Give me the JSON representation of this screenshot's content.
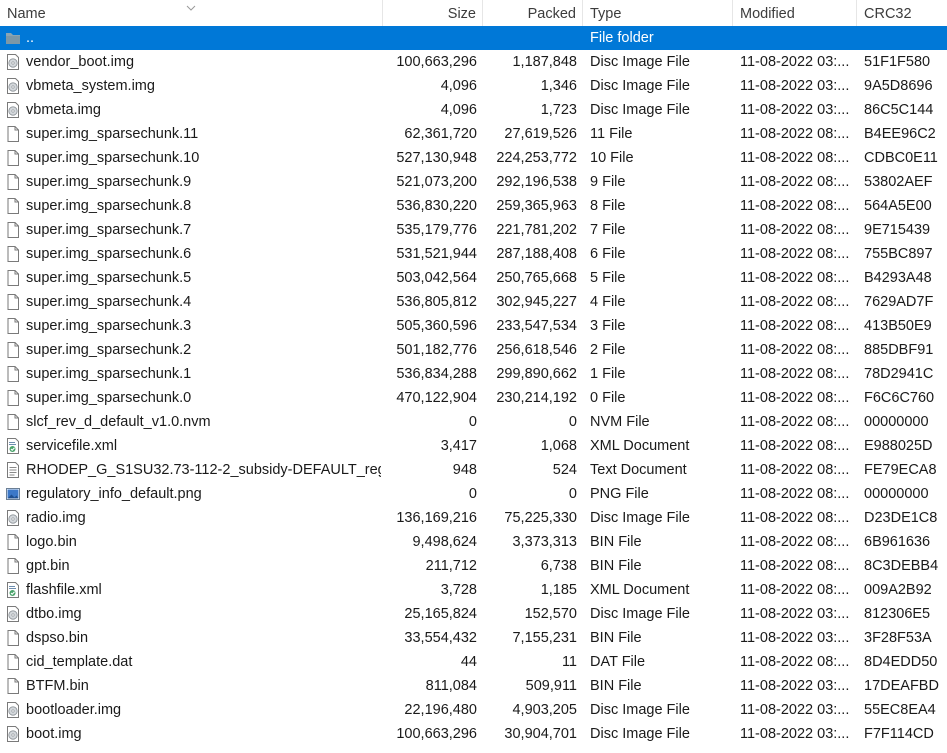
{
  "columns": {
    "name": "Name",
    "size": "Size",
    "packed": "Packed",
    "type": "Type",
    "modified": "Modified",
    "crc": "CRC32"
  },
  "sort": {
    "column": "name",
    "icon": "chevron-down-icon"
  },
  "colors": {
    "selection": "#0078d7",
    "header_text": "#3c3c3c",
    "folder": "#8ba5b3"
  },
  "rows": [
    {
      "name": "..",
      "size": "",
      "packed": "",
      "type": "File folder",
      "modified": "",
      "crc": "",
      "icon": "folder-icon",
      "selected": true
    },
    {
      "name": "vendor_boot.img",
      "size": "100,663,296",
      "packed": "1,187,848",
      "type": "Disc Image File",
      "modified": "11-08-2022 03:...",
      "crc": "51F1F580",
      "icon": "disc-image-icon"
    },
    {
      "name": "vbmeta_system.img",
      "size": "4,096",
      "packed": "1,346",
      "type": "Disc Image File",
      "modified": "11-08-2022 03:...",
      "crc": "9A5D8696",
      "icon": "disc-image-icon"
    },
    {
      "name": "vbmeta.img",
      "size": "4,096",
      "packed": "1,723",
      "type": "Disc Image File",
      "modified": "11-08-2022 03:...",
      "crc": "86C5C144",
      "icon": "disc-image-icon"
    },
    {
      "name": "super.img_sparsechunk.11",
      "size": "62,361,720",
      "packed": "27,619,526",
      "type": "11 File",
      "modified": "11-08-2022 08:...",
      "crc": "B4EE96C2",
      "icon": "file-icon"
    },
    {
      "name": "super.img_sparsechunk.10",
      "size": "527,130,948",
      "packed": "224,253,772",
      "type": "10 File",
      "modified": "11-08-2022 08:...",
      "crc": "CDBC0E11",
      "icon": "file-icon"
    },
    {
      "name": "super.img_sparsechunk.9",
      "size": "521,073,200",
      "packed": "292,196,538",
      "type": "9 File",
      "modified": "11-08-2022 08:...",
      "crc": "53802AEF",
      "icon": "file-icon"
    },
    {
      "name": "super.img_sparsechunk.8",
      "size": "536,830,220",
      "packed": "259,365,963",
      "type": "8 File",
      "modified": "11-08-2022 08:...",
      "crc": "564A5E00",
      "icon": "file-icon"
    },
    {
      "name": "super.img_sparsechunk.7",
      "size": "535,179,776",
      "packed": "221,781,202",
      "type": "7 File",
      "modified": "11-08-2022 08:...",
      "crc": "9E715439",
      "icon": "file-icon"
    },
    {
      "name": "super.img_sparsechunk.6",
      "size": "531,521,944",
      "packed": "287,188,408",
      "type": "6 File",
      "modified": "11-08-2022 08:...",
      "crc": "755BC897",
      "icon": "file-icon"
    },
    {
      "name": "super.img_sparsechunk.5",
      "size": "503,042,564",
      "packed": "250,765,668",
      "type": "5 File",
      "modified": "11-08-2022 08:...",
      "crc": "B4293A48",
      "icon": "file-icon"
    },
    {
      "name": "super.img_sparsechunk.4",
      "size": "536,805,812",
      "packed": "302,945,227",
      "type": "4 File",
      "modified": "11-08-2022 08:...",
      "crc": "7629AD7F",
      "icon": "file-icon"
    },
    {
      "name": "super.img_sparsechunk.3",
      "size": "505,360,596",
      "packed": "233,547,534",
      "type": "3 File",
      "modified": "11-08-2022 08:...",
      "crc": "413B50E9",
      "icon": "file-icon"
    },
    {
      "name": "super.img_sparsechunk.2",
      "size": "501,182,776",
      "packed": "256,618,546",
      "type": "2 File",
      "modified": "11-08-2022 08:...",
      "crc": "885DBF91",
      "icon": "file-icon"
    },
    {
      "name": "super.img_sparsechunk.1",
      "size": "536,834,288",
      "packed": "299,890,662",
      "type": "1 File",
      "modified": "11-08-2022 08:...",
      "crc": "78D2941C",
      "icon": "file-icon"
    },
    {
      "name": "super.img_sparsechunk.0",
      "size": "470,122,904",
      "packed": "230,214,192",
      "type": "0 File",
      "modified": "11-08-2022 08:...",
      "crc": "F6C6C760",
      "icon": "file-icon"
    },
    {
      "name": "slcf_rev_d_default_v1.0.nvm",
      "size": "0",
      "packed": "0",
      "type": "NVM File",
      "modified": "11-08-2022 08:...",
      "crc": "00000000",
      "icon": "file-icon"
    },
    {
      "name": "servicefile.xml",
      "size": "3,417",
      "packed": "1,068",
      "type": "XML Document",
      "modified": "11-08-2022 08:...",
      "crc": "E988025D",
      "icon": "xml-icon"
    },
    {
      "name": "RHODEP_G_S1SU32.73-112-2_subsidy-DEFAULT_reg...",
      "size": "948",
      "packed": "524",
      "type": "Text Document",
      "modified": "11-08-2022 08:...",
      "crc": "FE79ECA8",
      "icon": "text-file-icon"
    },
    {
      "name": "regulatory_info_default.png",
      "size": "0",
      "packed": "0",
      "type": "PNG File",
      "modified": "11-08-2022 08:...",
      "crc": "00000000",
      "icon": "image-icon"
    },
    {
      "name": "radio.img",
      "size": "136,169,216",
      "packed": "75,225,330",
      "type": "Disc Image File",
      "modified": "11-08-2022 08:...",
      "crc": "D23DE1C8",
      "icon": "disc-image-icon"
    },
    {
      "name": "logo.bin",
      "size": "9,498,624",
      "packed": "3,373,313",
      "type": "BIN File",
      "modified": "11-08-2022 08:...",
      "crc": "6B961636",
      "icon": "file-icon"
    },
    {
      "name": "gpt.bin",
      "size": "211,712",
      "packed": "6,738",
      "type": "BIN File",
      "modified": "11-08-2022 08:...",
      "crc": "8C3DEBB4",
      "icon": "file-icon"
    },
    {
      "name": "flashfile.xml",
      "size": "3,728",
      "packed": "1,185",
      "type": "XML Document",
      "modified": "11-08-2022 08:...",
      "crc": "009A2B92",
      "icon": "xml-icon"
    },
    {
      "name": "dtbo.img",
      "size": "25,165,824",
      "packed": "152,570",
      "type": "Disc Image File",
      "modified": "11-08-2022 03:...",
      "crc": "812306E5",
      "icon": "disc-image-icon"
    },
    {
      "name": "dspso.bin",
      "size": "33,554,432",
      "packed": "7,155,231",
      "type": "BIN File",
      "modified": "11-08-2022 03:...",
      "crc": "3F28F53A",
      "icon": "file-icon"
    },
    {
      "name": "cid_template.dat",
      "size": "44",
      "packed": "11",
      "type": "DAT File",
      "modified": "11-08-2022 08:...",
      "crc": "8D4EDD50",
      "icon": "file-icon"
    },
    {
      "name": "BTFM.bin",
      "size": "811,084",
      "packed": "509,911",
      "type": "BIN File",
      "modified": "11-08-2022 03:...",
      "crc": "17DEAFBD",
      "icon": "file-icon"
    },
    {
      "name": "bootloader.img",
      "size": "22,196,480",
      "packed": "4,903,205",
      "type": "Disc Image File",
      "modified": "11-08-2022 03:...",
      "crc": "55EC8EA4",
      "icon": "disc-image-icon"
    },
    {
      "name": "boot.img",
      "size": "100,663,296",
      "packed": "30,904,701",
      "type": "Disc Image File",
      "modified": "11-08-2022 03:...",
      "crc": "F7F114CD",
      "icon": "disc-image-icon"
    }
  ]
}
